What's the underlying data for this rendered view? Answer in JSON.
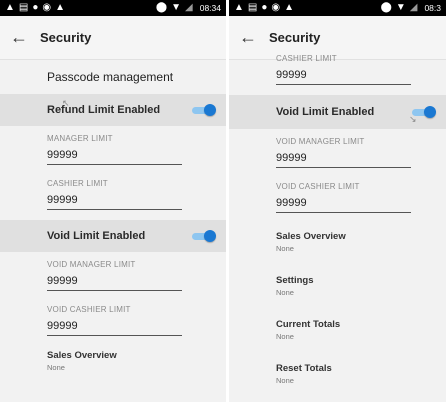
{
  "status_bar": {
    "time_left": "08:34",
    "time_right": "08:3",
    "icons": [
      "warning-icon",
      "message-icon",
      "info-icon",
      "circle-icon",
      "warning-icon"
    ],
    "right_icons": [
      "location-icon",
      "wifi-icon",
      "signal-icon"
    ]
  },
  "header": {
    "back_glyph": "←",
    "title": "Security"
  },
  "left": {
    "passcode_management": "Passcode management",
    "refund_toggle_label": "Refund Limit Enabled",
    "refund_enabled": true,
    "manager_limit_label": "MANAGER LIMIT",
    "manager_limit_value": "99999",
    "cashier_limit_label": "CASHIER LIMIT",
    "cashier_limit_value": "99999",
    "void_toggle_label": "Void Limit Enabled",
    "void_enabled": true,
    "void_manager_label": "VOID MANAGER LIMIT",
    "void_manager_value": "99999",
    "void_cashier_label": "VOID CASHIER LIMIT",
    "void_cashier_value": "99999",
    "sales_overview_title": "Sales Overview",
    "sales_overview_sub": "None"
  },
  "right": {
    "cashier_limit_label": "CASHIER LIMIT",
    "cashier_limit_value": "99999",
    "void_toggle_label": "Void Limit Enabled",
    "void_enabled": true,
    "void_manager_label": "VOID MANAGER LIMIT",
    "void_manager_value": "99999",
    "void_cashier_label": "VOID CASHIER LIMIT",
    "void_cashier_value": "99999",
    "nav": [
      {
        "title": "Sales Overview",
        "sub": "None"
      },
      {
        "title": "Settings",
        "sub": "None"
      },
      {
        "title": "Current Totals",
        "sub": "None"
      },
      {
        "title": "Reset Totals",
        "sub": "None"
      }
    ]
  },
  "colors": {
    "accent": "#1a78d2",
    "track": "#8ec6f0",
    "highlight_row": "#e0e0e0",
    "background": "#f2f2f2"
  }
}
